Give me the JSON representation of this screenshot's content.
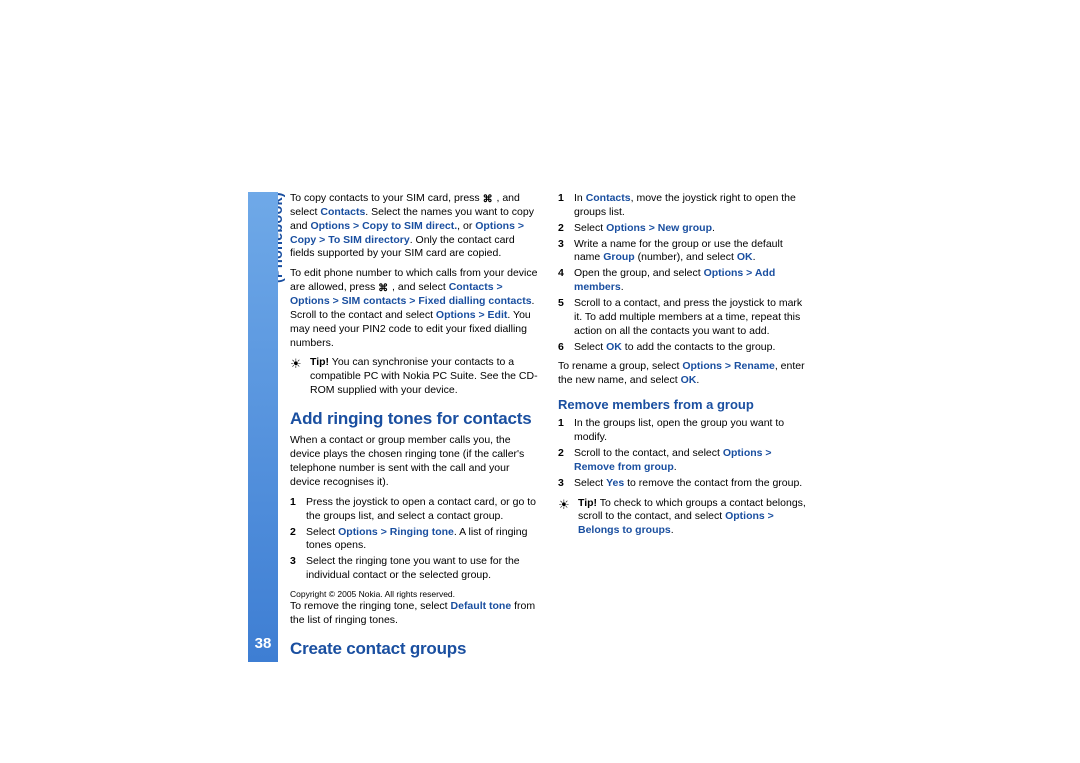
{
  "section": "Contacts (Phonebook)",
  "page_number": "38",
  "col1": {
    "p1": {
      "a": "To copy contacts to your SIM card, press ",
      "b": " , and select ",
      "contacts": "Contacts",
      "c": ". Select the names you want to copy and ",
      "opt1": "Options > Copy to SIM direct.",
      "d": ", or ",
      "opt2": "Options > Copy > To SIM directory",
      "e": ". Only the contact card fields supported by your SIM card are copied."
    },
    "p2": {
      "a": "To edit phone number to which calls from your device are allowed, press ",
      "b": " , and select ",
      "path1": "Contacts > Options > SIM contacts > Fixed dialling contacts",
      "c": ". Scroll to the contact and select ",
      "path2": "Options > Edit",
      "d": ". You may need your PIN2 code to edit your fixed dialling numbers."
    },
    "tip1": {
      "label": "Tip!",
      "text": " You can synchronise your contacts to a compatible PC with Nokia PC Suite. See the CD-ROM supplied with your device."
    },
    "h2_1": "Add ringing tones for contacts",
    "p3": "When a contact or group member calls you, the device plays the chosen ringing tone (if the caller's telephone number is sent with the call and your device recognises it).",
    "steps1": {
      "s1": "Press the joystick to open a contact card, or go to the groups list, and select a contact group.",
      "s2a": "Select ",
      "s2b": "Options > Ringing tone",
      "s2c": ". A list of ringing tones opens.",
      "s3": "Select the ringing tone you want to use for the individual contact or the selected group."
    }
  },
  "col2": {
    "p4a": "To remove the ringing tone, select ",
    "p4b": "Default tone",
    "p4c": " from the list of ringing tones.",
    "h2_2": "Create contact groups",
    "steps2": {
      "s1a": "In ",
      "s1b": "Contacts",
      "s1c": ", move the joystick right to open the groups list.",
      "s2a": "Select ",
      "s2b": "Options > New group",
      "s2c": ".",
      "s3a": "Write a name for the group or use the default name ",
      "s3b": "Group",
      "s3c": " (number), and select ",
      "s3d": "OK",
      "s3e": ".",
      "s4a": "Open the group, and select ",
      "s4b": "Options > Add members",
      "s4c": ".",
      "s5": "Scroll to a contact, and press the joystick to mark it. To add multiple members at a time, repeat this action on all the contacts you want to add.",
      "s6a": "Select ",
      "s6b": "OK",
      "s6c": " to add the contacts to the group."
    },
    "p5a": "To rename a group, select ",
    "p5b": "Options > Rename",
    "p5c": ", enter the new name, and select ",
    "p5d": "OK",
    "p5e": ".",
    "h3_1": "Remove members from a group",
    "steps3": {
      "s1": "In the groups list, open the group you want to modify.",
      "s2a": "Scroll to the contact, and select ",
      "s2b": "Options > Remove from group",
      "s2c": ".",
      "s3a": "Select ",
      "s3b": "Yes",
      "s3c": " to remove the contact from the group."
    },
    "tip2": {
      "label": "Tip!",
      "a": " To check to which groups a contact belongs, scroll to the contact, and select ",
      "b": "Options > Belongs to groups",
      "c": "."
    }
  },
  "footer": "Copyright © 2005 Nokia. All rights reserved.",
  "icons": {
    "key": "⌘"
  }
}
